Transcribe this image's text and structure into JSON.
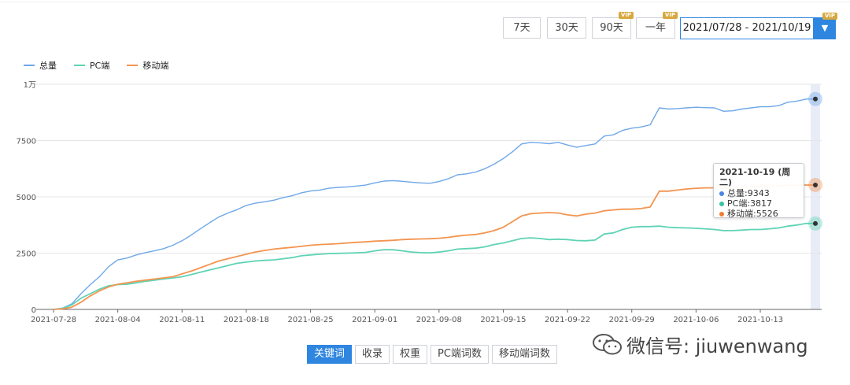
{
  "range_buttons": [
    {
      "label": "7天",
      "vip": ""
    },
    {
      "label": "30天",
      "vip": ""
    },
    {
      "label": "90天",
      "vip": "VIP"
    },
    {
      "label": "一年",
      "vip": "VIP"
    }
  ],
  "date_range": {
    "value": "2021/07/28 - 2021/10/19",
    "vip": "VIP",
    "dropdown_icon": "caret-down-icon"
  },
  "tabs": [
    "关键词",
    "收录",
    "权重",
    "PC端词数",
    "移动端词数"
  ],
  "active_tab": "关键词",
  "watermark": {
    "icon": "wechat-icon",
    "text": "微信号: jiuwenwang"
  },
  "tooltip": {
    "title": "2021-10-19 (周二)",
    "rows": [
      "总量:9343",
      "PC端:3817",
      "移动端:5526"
    ]
  },
  "colors": {
    "total": "#6fa8e8",
    "pc": "#5fd3b5",
    "mobile": "#f39450",
    "accent": "#2f86e0",
    "hover_band": "#e8ecf6"
  },
  "chart_data": {
    "type": "line",
    "x_ticks": [
      "2021-07-28",
      "2021-08-04",
      "2021-08-11",
      "2021-08-18",
      "2021-08-25",
      "2021-09-01",
      "2021-09-08",
      "2021-09-15",
      "2021-09-22",
      "2021-09-29",
      "2021-10-06",
      "2021-10-13"
    ],
    "y_ticks": [
      "0",
      "2500",
      "5000",
      "7500",
      "1万"
    ],
    "ylim": [
      0,
      10000
    ],
    "xlim_days": [
      0,
      83
    ],
    "x_start": "2021-07-28",
    "grid": "horizontal",
    "legend_position": "top-left",
    "series": [
      {
        "name": "总量",
        "values": [
          [
            0,
            0
          ],
          [
            1,
            60
          ],
          [
            2,
            250
          ],
          [
            3,
            700
          ],
          [
            4,
            1100
          ],
          [
            5,
            1450
          ],
          [
            6,
            1900
          ],
          [
            7,
            2200
          ],
          [
            8,
            2280
          ],
          [
            9,
            2420
          ],
          [
            10,
            2520
          ],
          [
            11,
            2600
          ],
          [
            12,
            2700
          ],
          [
            13,
            2850
          ],
          [
            14,
            3050
          ],
          [
            15,
            3300
          ],
          [
            16,
            3580
          ],
          [
            17,
            3850
          ],
          [
            18,
            4100
          ],
          [
            19,
            4280
          ],
          [
            20,
            4430
          ],
          [
            21,
            4620
          ],
          [
            22,
            4720
          ],
          [
            23,
            4780
          ],
          [
            24,
            4850
          ],
          [
            25,
            4960
          ],
          [
            26,
            5050
          ],
          [
            27,
            5180
          ],
          [
            28,
            5260
          ],
          [
            29,
            5300
          ],
          [
            30,
            5380
          ],
          [
            31,
            5420
          ],
          [
            32,
            5440
          ],
          [
            33,
            5480
          ],
          [
            34,
            5520
          ],
          [
            35,
            5620
          ],
          [
            36,
            5700
          ],
          [
            37,
            5720
          ],
          [
            38,
            5690
          ],
          [
            39,
            5650
          ],
          [
            40,
            5620
          ],
          [
            41,
            5600
          ],
          [
            42,
            5680
          ],
          [
            43,
            5800
          ],
          [
            44,
            5980
          ],
          [
            45,
            6020
          ],
          [
            46,
            6100
          ],
          [
            47,
            6250
          ],
          [
            48,
            6450
          ],
          [
            49,
            6700
          ],
          [
            50,
            7000
          ],
          [
            51,
            7350
          ],
          [
            52,
            7420
          ],
          [
            53,
            7400
          ],
          [
            54,
            7360
          ],
          [
            55,
            7420
          ],
          [
            56,
            7300
          ],
          [
            57,
            7200
          ],
          [
            58,
            7280
          ],
          [
            59,
            7350
          ],
          [
            60,
            7700
          ],
          [
            61,
            7750
          ],
          [
            62,
            7950
          ],
          [
            63,
            8050
          ],
          [
            64,
            8100
          ],
          [
            65,
            8200
          ],
          [
            66,
            8950
          ],
          [
            67,
            8900
          ],
          [
            68,
            8920
          ],
          [
            69,
            8950
          ],
          [
            70,
            8980
          ],
          [
            71,
            8960
          ],
          [
            72,
            8950
          ],
          [
            73,
            8800
          ],
          [
            74,
            8820
          ],
          [
            75,
            8900
          ],
          [
            76,
            8950
          ],
          [
            77,
            9000
          ],
          [
            78,
            9000
          ],
          [
            79,
            9050
          ],
          [
            80,
            9200
          ],
          [
            81,
            9250
          ],
          [
            82,
            9343
          ],
          [
            83,
            9343
          ]
        ]
      },
      {
        "name": "PC端",
        "values": [
          [
            0,
            0
          ],
          [
            1,
            50
          ],
          [
            2,
            200
          ],
          [
            3,
            500
          ],
          [
            4,
            700
          ],
          [
            5,
            900
          ],
          [
            6,
            1050
          ],
          [
            7,
            1100
          ],
          [
            8,
            1120
          ],
          [
            9,
            1180
          ],
          [
            10,
            1250
          ],
          [
            11,
            1300
          ],
          [
            12,
            1350
          ],
          [
            13,
            1400
          ],
          [
            14,
            1450
          ],
          [
            15,
            1550
          ],
          [
            16,
            1650
          ],
          [
            17,
            1750
          ],
          [
            18,
            1850
          ],
          [
            19,
            1950
          ],
          [
            20,
            2050
          ],
          [
            21,
            2100
          ],
          [
            22,
            2150
          ],
          [
            23,
            2180
          ],
          [
            24,
            2200
          ],
          [
            25,
            2250
          ],
          [
            26,
            2300
          ],
          [
            27,
            2380
          ],
          [
            28,
            2420
          ],
          [
            29,
            2450
          ],
          [
            30,
            2480
          ],
          [
            31,
            2490
          ],
          [
            32,
            2500
          ],
          [
            33,
            2510
          ],
          [
            34,
            2530
          ],
          [
            35,
            2600
          ],
          [
            36,
            2650
          ],
          [
            37,
            2650
          ],
          [
            38,
            2600
          ],
          [
            39,
            2550
          ],
          [
            40,
            2520
          ],
          [
            41,
            2510
          ],
          [
            42,
            2550
          ],
          [
            43,
            2600
          ],
          [
            44,
            2680
          ],
          [
            45,
            2700
          ],
          [
            46,
            2720
          ],
          [
            47,
            2780
          ],
          [
            48,
            2880
          ],
          [
            49,
            2950
          ],
          [
            50,
            3050
          ],
          [
            51,
            3150
          ],
          [
            52,
            3180
          ],
          [
            53,
            3150
          ],
          [
            54,
            3100
          ],
          [
            55,
            3120
          ],
          [
            56,
            3100
          ],
          [
            57,
            3060
          ],
          [
            58,
            3050
          ],
          [
            59,
            3080
          ],
          [
            60,
            3350
          ],
          [
            61,
            3400
          ],
          [
            62,
            3550
          ],
          [
            63,
            3650
          ],
          [
            64,
            3680
          ],
          [
            65,
            3680
          ],
          [
            66,
            3700
          ],
          [
            67,
            3650
          ],
          [
            68,
            3630
          ],
          [
            69,
            3620
          ],
          [
            70,
            3600
          ],
          [
            71,
            3580
          ],
          [
            72,
            3550
          ],
          [
            73,
            3500
          ],
          [
            74,
            3500
          ],
          [
            75,
            3520
          ],
          [
            76,
            3550
          ],
          [
            77,
            3550
          ],
          [
            78,
            3580
          ],
          [
            79,
            3620
          ],
          [
            80,
            3700
          ],
          [
            81,
            3750
          ],
          [
            82,
            3817
          ],
          [
            83,
            3817
          ]
        ]
      },
      {
        "name": "移动端",
        "values": [
          [
            0,
            0
          ],
          [
            1,
            20
          ],
          [
            2,
            100
          ],
          [
            3,
            320
          ],
          [
            4,
            600
          ],
          [
            5,
            820
          ],
          [
            6,
            1000
          ],
          [
            7,
            1120
          ],
          [
            8,
            1180
          ],
          [
            9,
            1250
          ],
          [
            10,
            1300
          ],
          [
            11,
            1350
          ],
          [
            12,
            1400
          ],
          [
            13,
            1450
          ],
          [
            14,
            1580
          ],
          [
            15,
            1700
          ],
          [
            16,
            1850
          ],
          [
            17,
            2000
          ],
          [
            18,
            2150
          ],
          [
            19,
            2250
          ],
          [
            20,
            2350
          ],
          [
            21,
            2450
          ],
          [
            22,
            2550
          ],
          [
            23,
            2620
          ],
          [
            24,
            2680
          ],
          [
            25,
            2720
          ],
          [
            26,
            2760
          ],
          [
            27,
            2800
          ],
          [
            28,
            2850
          ],
          [
            29,
            2880
          ],
          [
            30,
            2900
          ],
          [
            31,
            2920
          ],
          [
            32,
            2950
          ],
          [
            33,
            2980
          ],
          [
            34,
            3000
          ],
          [
            35,
            3030
          ],
          [
            36,
            3050
          ],
          [
            37,
            3070
          ],
          [
            38,
            3100
          ],
          [
            39,
            3120
          ],
          [
            40,
            3130
          ],
          [
            41,
            3140
          ],
          [
            42,
            3160
          ],
          [
            43,
            3200
          ],
          [
            44,
            3260
          ],
          [
            45,
            3300
          ],
          [
            46,
            3330
          ],
          [
            47,
            3400
          ],
          [
            48,
            3500
          ],
          [
            49,
            3650
          ],
          [
            50,
            3900
          ],
          [
            51,
            4150
          ],
          [
            52,
            4250
          ],
          [
            53,
            4280
          ],
          [
            54,
            4300
          ],
          [
            55,
            4280
          ],
          [
            56,
            4200
          ],
          [
            57,
            4150
          ],
          [
            58,
            4230
          ],
          [
            59,
            4280
          ],
          [
            60,
            4380
          ],
          [
            61,
            4420
          ],
          [
            62,
            4450
          ],
          [
            63,
            4450
          ],
          [
            64,
            4480
          ],
          [
            65,
            4550
          ],
          [
            66,
            5250
          ],
          [
            67,
            5250
          ],
          [
            68,
            5300
          ],
          [
            69,
            5350
          ],
          [
            70,
            5380
          ],
          [
            71,
            5400
          ],
          [
            72,
            5400
          ],
          [
            73,
            5380
          ],
          [
            74,
            5400
          ],
          [
            75,
            5420
          ],
          [
            76,
            5440
          ],
          [
            77,
            5460
          ],
          [
            78,
            5470
          ],
          [
            79,
            5490
          ],
          [
            80,
            5510
          ],
          [
            81,
            5520
          ],
          [
            82,
            5526
          ],
          [
            83,
            5526
          ]
        ]
      }
    ]
  }
}
